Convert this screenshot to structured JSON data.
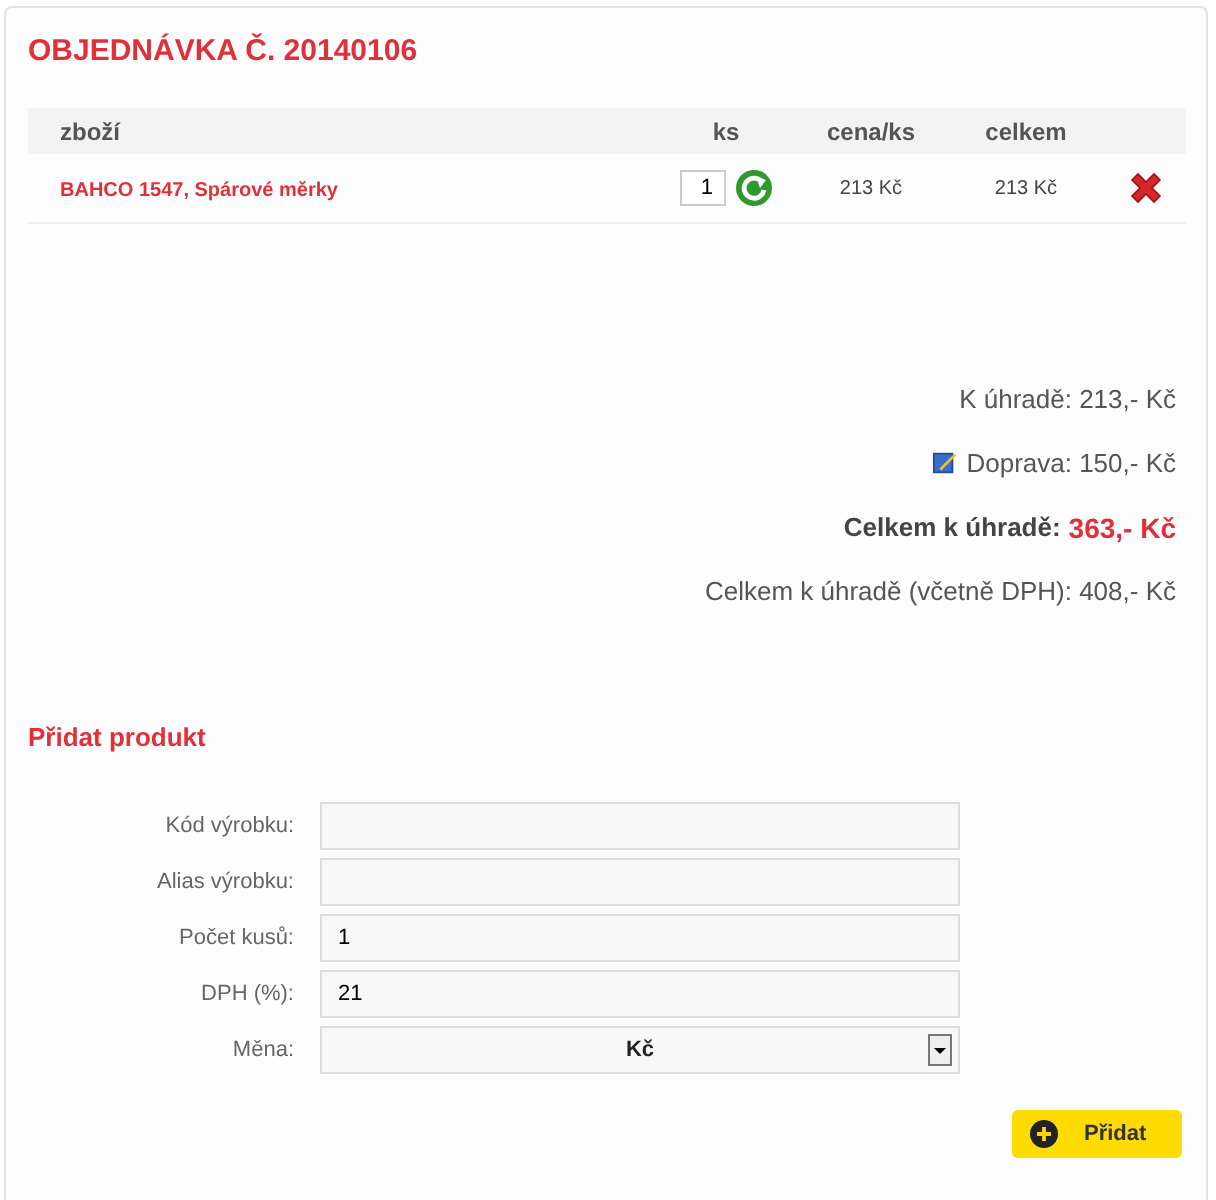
{
  "title": "OBJEDNÁVKA Č. 20140106",
  "table": {
    "columns": [
      "zboží",
      "ks",
      "cena/ks",
      "celkem"
    ],
    "rows": [
      {
        "product": "BAHCO 1547, Spárové měrky",
        "quantity": "1",
        "unit_price": "213 Kč",
        "total": "213 Kč"
      }
    ]
  },
  "totals": [
    {
      "kind": "plain",
      "label": "K úhradě:",
      "value": "213,- Kč"
    },
    {
      "kind": "shipping",
      "label": "Doprava:",
      "value": "150,- Kč"
    },
    {
      "kind": "grand",
      "label": "Celkem k úhradě:",
      "value": "363,- Kč"
    },
    {
      "kind": "plain",
      "label": "Celkem k úhradě (včetně DPH):",
      "value": "408,- Kč"
    }
  ],
  "add_product": {
    "title": "Přidat produkt",
    "fields": [
      {
        "kind": "text",
        "label": "Kód výrobku:"
      },
      {
        "kind": "text",
        "label": "Alias výrobku:"
      },
      {
        "kind": "text",
        "label": "Počet kusů:",
        "value": "1"
      },
      {
        "kind": "text",
        "label": "DPH (%):",
        "value": "21"
      },
      {
        "kind": "select",
        "label": "Měna:",
        "value": "Kč"
      }
    ],
    "button": "Přidat"
  }
}
